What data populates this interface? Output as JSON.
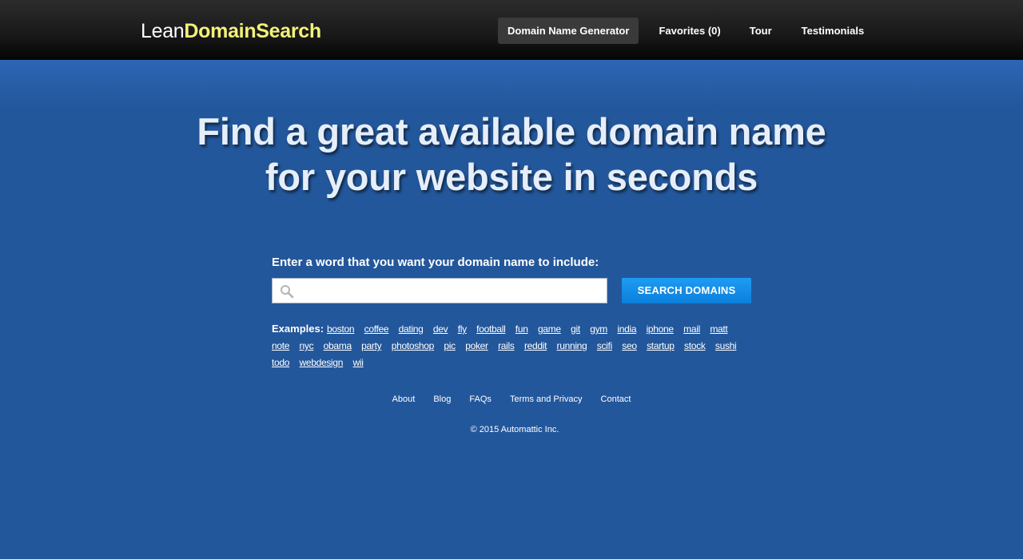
{
  "colors": {
    "background": "#23579b",
    "topbar": "#1a1a1a",
    "logo_accent": "#f2f27a",
    "button": "#1089e6",
    "nav_active": "#3a3a3a"
  },
  "logo": {
    "part1": "Lean",
    "part2": "DomainSearch"
  },
  "nav": {
    "items": [
      {
        "label": "Domain Name Generator",
        "active": true
      },
      {
        "label": "Favorites (0)"
      },
      {
        "label": "Tour"
      },
      {
        "label": "Testimonials"
      }
    ]
  },
  "hero": {
    "line1": "Find a great available domain name",
    "line2": "for your website in seconds"
  },
  "search": {
    "label": "Enter a word that you want your domain name to include:",
    "value": "",
    "placeholder": "",
    "icon": "search-icon",
    "button_label": "SEARCH DOMAINS"
  },
  "examples": {
    "label": "Examples:",
    "words": [
      "boston",
      "coffee",
      "dating",
      "dev",
      "fly",
      "football",
      "fun",
      "game",
      "git",
      "gym",
      "india",
      "iphone",
      "mail",
      "matt",
      "note",
      "nyc",
      "obama",
      "party",
      "photoshop",
      "pic",
      "poker",
      "rails",
      "reddit",
      "running",
      "scifi",
      "seo",
      "startup",
      "stock",
      "sushi",
      "todo",
      "webdesign",
      "wii"
    ]
  },
  "footer": {
    "links": [
      "About",
      "Blog",
      "FAQs",
      "Terms and Privacy",
      "Contact"
    ],
    "copyright": "© 2015 Automattic Inc."
  }
}
